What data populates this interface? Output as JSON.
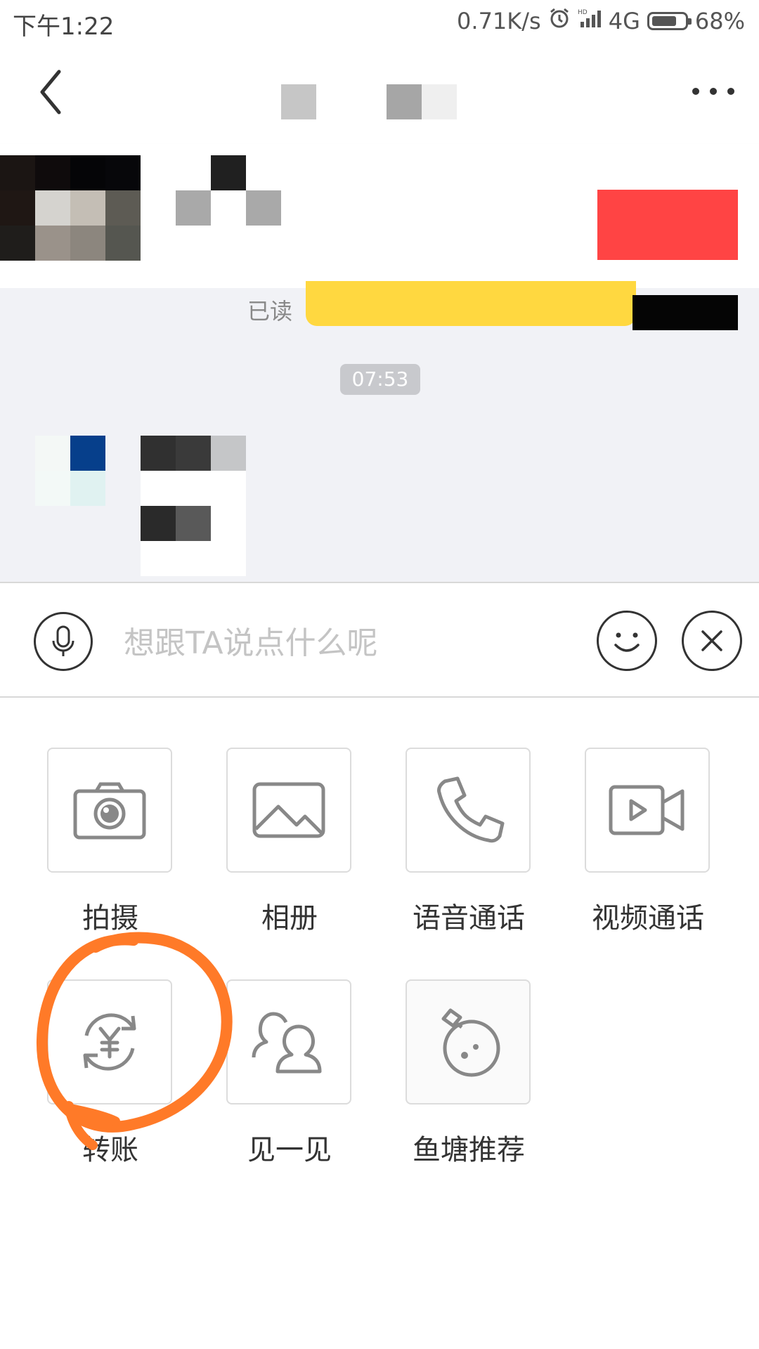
{
  "status_bar": {
    "time": "下午1:22",
    "net_speed": "0.71K/s",
    "network": "4G",
    "battery": "68%"
  },
  "chat": {
    "read_label": "已读",
    "timestamp": "07:53"
  },
  "composer": {
    "placeholder": "想跟TA说点什么呢"
  },
  "tools": [
    {
      "label": "拍摄",
      "icon": "camera-icon"
    },
    {
      "label": "相册",
      "icon": "photo-album-icon"
    },
    {
      "label": "语音通话",
      "icon": "phone-icon"
    },
    {
      "label": "视频通话",
      "icon": "video-camera-icon"
    },
    {
      "label": "转账",
      "icon": "transfer-yuan-icon"
    },
    {
      "label": "见一见",
      "icon": "meet-people-icon"
    },
    {
      "label": "鱼塘推荐",
      "icon": "fish-pond-icon"
    }
  ],
  "colors": {
    "accent_yellow": "#ffd840",
    "tag_red": "#ff4444",
    "annotation_orange": "#ff7a28",
    "chat_bg": "#f1f2f6"
  }
}
